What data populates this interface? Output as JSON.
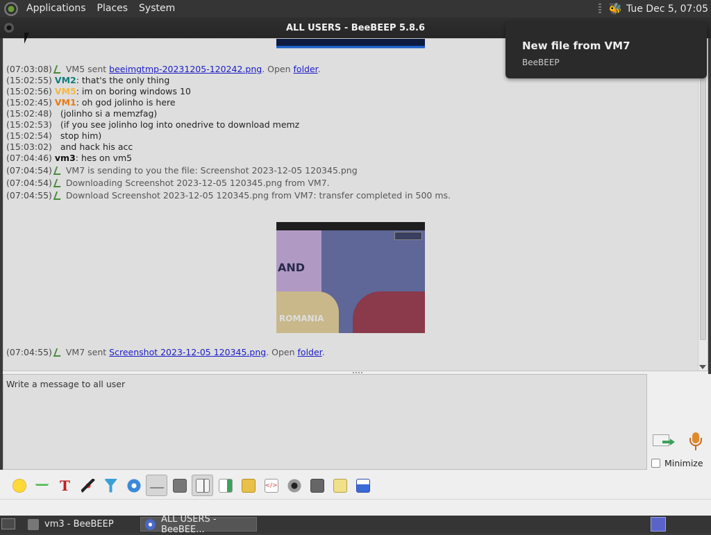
{
  "top_panel": {
    "menus": [
      "Applications",
      "Places",
      "System"
    ],
    "clock": "Tue Dec  5, 07:05"
  },
  "window": {
    "title": "ALL USERS - BeeBEEP 5.8.6"
  },
  "notification": {
    "title": "New file from VM7",
    "body": "BeeBEEP"
  },
  "chat": {
    "l1": {
      "ts": "(07:03:08)",
      "pre": " VM5 sent ",
      "link": "beeimgtmp-20231205-120242.png",
      "mid": ". Open ",
      "link2": "folder",
      "post": "."
    },
    "l2": {
      "ts": "(15:02:55)",
      "user": "VM2",
      "text": ": that's the only thing"
    },
    "l3": {
      "ts": "(15:02:56)",
      "user": "VM5",
      "text": ": im on boring windows 10"
    },
    "l4": {
      "ts": "(15:02:45)",
      "user": "VM1",
      "text": ": oh god jolinho is here"
    },
    "l5": {
      "ts": "(15:02:48)",
      "text": "   (jolinho si a memzfag)"
    },
    "l6": {
      "ts": "(15:02:53)",
      "text": "   (if you see jolinho log into onedrive to download memz"
    },
    "l7": {
      "ts": "(15:02:54)",
      "text": "   stop him)"
    },
    "l8": {
      "ts": "(15:03:02)",
      "text": "   and hack his acc"
    },
    "l9": {
      "ts": "(07:04:46)",
      "user": "vm3",
      "text": ": hes on vm5"
    },
    "l10": {
      "ts": "(07:04:54)",
      "text": " VM7 is sending to you the file: Screenshot 2023-12-05 120345.png"
    },
    "l11": {
      "ts": "(07:04:54)",
      "text": " Downloading Screenshot 2023-12-05 120345.png from VM7."
    },
    "l12": {
      "ts": "(07:04:55)",
      "text": " Download Screenshot 2023-12-05 120345.png from VM7: transfer completed in 500 ms."
    },
    "map_labels": {
      "land": "AND",
      "romania": "ROMANIA"
    },
    "l13": {
      "ts": "(07:04:55)",
      "pre": " VM7 sent ",
      "link": "Screenshot 2023-12-05 120345.png",
      "mid": ". Open ",
      "link2": "folder",
      "post": "."
    }
  },
  "input": {
    "value": "Write a message to all user"
  },
  "send_panel": {
    "minimize_label": "Minimize"
  },
  "toolbar": {
    "icons": [
      "smiley-icon",
      "download-icon",
      "font-icon",
      "color-picker-icon",
      "filter-icon",
      "settings-icon",
      "enter-key-icon",
      "font-style-icon",
      "sound-icon",
      "send-file-icon",
      "send-folder-icon",
      "code-icon",
      "screenshot-icon",
      "keyboard-icon",
      "notes-icon",
      "save-icon"
    ]
  },
  "taskbar": {
    "tasks": [
      "vm3 - BeeBEEP",
      "ALL USERS - BeeBEE..."
    ]
  }
}
